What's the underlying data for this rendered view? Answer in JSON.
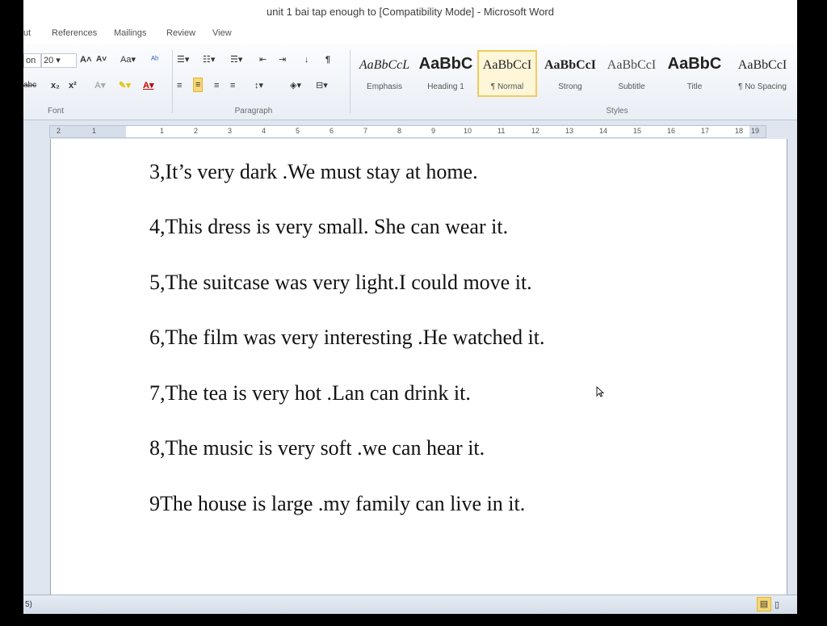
{
  "title": "unit 1 bai tap enough to [Compatibility Mode] - Microsoft Word",
  "tabs": [
    "ut",
    "References",
    "Mailings",
    "Review",
    "View"
  ],
  "font": {
    "name_partial": "on",
    "size": "20",
    "group_label": "Font"
  },
  "paragraph": {
    "group_label": "Paragraph"
  },
  "styles": {
    "group_label": "Styles",
    "items": [
      {
        "preview": "AaBbCcL",
        "name": "Emphasis"
      },
      {
        "preview": "AaBbC",
        "name": "Heading 1"
      },
      {
        "preview": "AaBbCcI",
        "name": "¶ Normal"
      },
      {
        "preview": "AaBbCcI",
        "name": "Strong"
      },
      {
        "preview": "AaBbCcI",
        "name": "Subtitle"
      },
      {
        "preview": "AaBbC",
        "name": "Title"
      },
      {
        "preview": "AaBbCcI",
        "name": "¶ No Spacing"
      }
    ]
  },
  "ruler": {
    "numbers": [
      "2",
      "1",
      "1",
      "2",
      "3",
      "4",
      "5",
      "6",
      "7",
      "8",
      "9",
      "10",
      "11",
      "12",
      "13",
      "14",
      "15",
      "16",
      "17",
      "18",
      "19"
    ]
  },
  "document": {
    "lines": [
      "3,It’s very dark .We must stay at home.",
      "4,This dress is very small. She can wear it.",
      "5,The suitcase was very light.I could move it.",
      "6,The film was very interesting .He watched it.",
      "7,The tea is very hot .Lan can drink it.",
      "8,The music is very soft .we can hear it.",
      "9The house is large .my family can live in it."
    ]
  },
  "status": {
    "left": "5)"
  }
}
